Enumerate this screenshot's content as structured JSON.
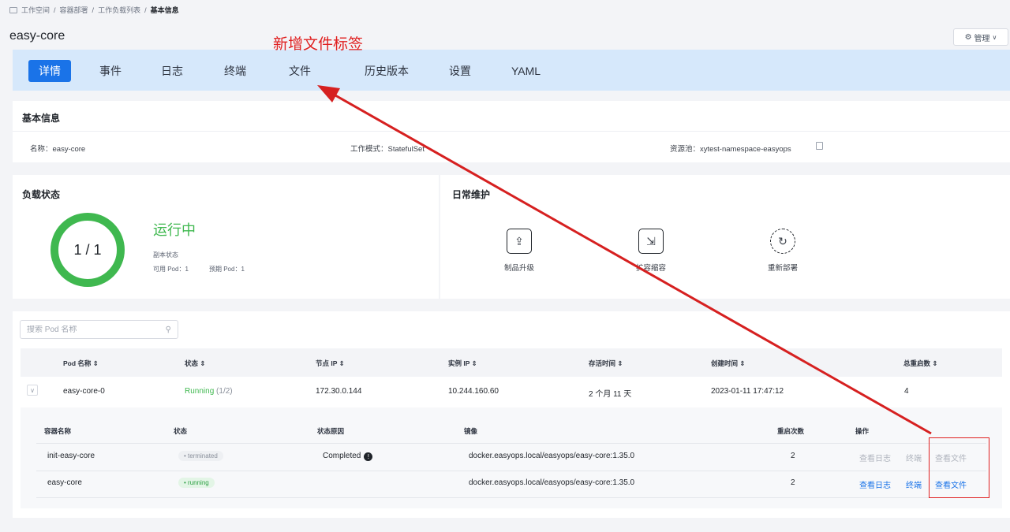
{
  "breadcrumb": [
    "工作空间",
    "/",
    "容器部署",
    "/",
    "工作负载列表",
    "/",
    "基本信息"
  ],
  "page_title": "easy-core",
  "manage_label": "管理",
  "tabs": [
    "详情",
    "事件",
    "日志",
    "终端",
    "文件",
    "历史版本",
    "设置",
    "YAML"
  ],
  "annotation": "新增文件标签",
  "basic": {
    "title": "基本信息",
    "name": "名称：easy-core",
    "mode": "工作模式：StatefulSet",
    "pool": "资源池：xytest-namespace-easyops"
  },
  "load": {
    "title": "负载状态",
    "ring": "1 / 1",
    "status": "运行中",
    "replica_label": "副本状态",
    "available": "可用 Pod：1",
    "expected": "预期 Pod：1"
  },
  "maintenance": {
    "title": "日常维护",
    "items": [
      "制品升级",
      "扩容缩容",
      "重新部署"
    ]
  },
  "search_placeholder": "搜索 Pod 名称",
  "pod_table": {
    "headers": [
      "Pod 名称 ⇕",
      "状态 ⇕",
      "节点 IP ⇕",
      "实例 IP ⇕",
      "存活时间 ⇕",
      "创建时间 ⇕",
      "总重启数 ⇕"
    ],
    "row": {
      "name": "easy-core-0",
      "status": "Running",
      "status_count": "(1/2)",
      "node_ip": "172.30.0.144",
      "instance_ip": "10.244.160.60",
      "uptime": "2 个月 11 天",
      "created": "2023-01-11 17:47:12",
      "restarts": "4"
    }
  },
  "container_table": {
    "headers": [
      "容器名称",
      "状态",
      "状态原因",
      "镜像",
      "重启次数",
      "操作"
    ],
    "rows": [
      {
        "name": "init-easy-core",
        "status": "• terminated",
        "reason": "Completed",
        "image": "docker.easyops.local/easyops/easy-core:1.35.0",
        "restarts": "2",
        "log": "查看日志",
        "terminal": "终端",
        "files": "查看文件"
      },
      {
        "name": "easy-core",
        "status": "• running",
        "reason": "",
        "image": "docker.easyops.local/easyops/easy-core:1.35.0",
        "restarts": "2",
        "log": "查看日志",
        "terminal": "终端",
        "files": "查看文件"
      }
    ]
  },
  "colors": {
    "accent": "#1a73e8",
    "tabbar": "#d6e8fb",
    "success": "#3fb84f",
    "annotation": "#e02020"
  }
}
